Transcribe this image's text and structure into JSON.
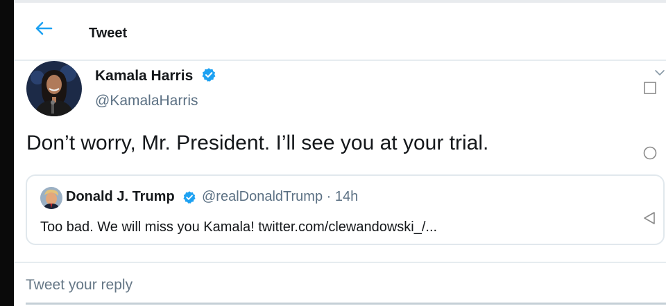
{
  "header": {
    "title": "Tweet"
  },
  "tweet": {
    "author_name": "Kamala Harris",
    "author_handle": "@KamalaHarris",
    "text": "Don’t worry, Mr. President. I’ll see you at your trial."
  },
  "quoted_tweet": {
    "author_name": "Donald J. Trump",
    "handle_and_time": "@realDonaldTrump · 14h",
    "text": "Too bad. We will miss you Kamala! twitter.com/clewandowski_/..."
  },
  "reply": {
    "placeholder": "Tweet your reply"
  },
  "icons": {
    "back": "arrow-left-icon",
    "verified": "verified-badge-icon",
    "more": "chevron-down-icon",
    "nav_square": "square-icon",
    "nav_circle": "circle-icon",
    "nav_back": "triangle-icon"
  },
  "colors": {
    "accent": "#1da1f2",
    "text": "#14171a",
    "secondary": "#5b7083",
    "border": "#e1e8ed"
  }
}
